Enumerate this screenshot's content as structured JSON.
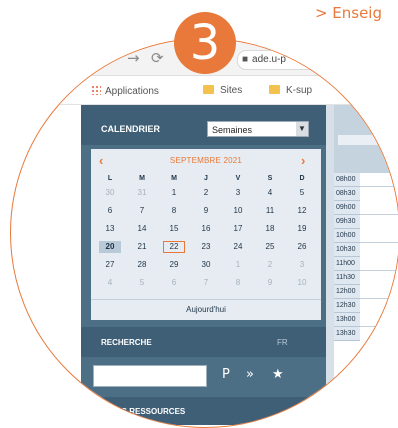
{
  "breadcrumb": "> Enseig",
  "step_badge": "3",
  "browser": {
    "url": "ade.u-p",
    "back_icon": "←",
    "forward_icon": "→",
    "reload_icon": "⟳",
    "bookmarks": [
      {
        "label": "Applications",
        "icon": "apps-grid-icon"
      },
      {
        "label": "Sites",
        "icon": "folder-icon"
      },
      {
        "label": "K-sup",
        "icon": "folder-icon"
      }
    ]
  },
  "calendar": {
    "title": "CALENDRIER",
    "view_select": "Semaines",
    "month": "SEPTEMBRE 2021",
    "weekdays": [
      "L",
      "M",
      "M",
      "J",
      "V",
      "S",
      "D"
    ],
    "weeks": [
      [
        "30",
        "31",
        "1",
        "2",
        "3",
        "4",
        "5"
      ],
      [
        "6",
        "7",
        "8",
        "9",
        "10",
        "11",
        "12"
      ],
      [
        "13",
        "14",
        "15",
        "16",
        "17",
        "18",
        "19"
      ],
      [
        "20",
        "21",
        "22",
        "23",
        "24",
        "25",
        "26"
      ],
      [
        "27",
        "28",
        "29",
        "30",
        "1",
        "2",
        "3"
      ],
      [
        "4",
        "5",
        "6",
        "7",
        "8",
        "9",
        "10"
      ]
    ],
    "today_label": "Aujourd'hui"
  },
  "search": {
    "title": "RECHERCHE",
    "lang": "FR",
    "input_value": "",
    "go_icon": "P",
    "more_icon": "»",
    "star_icon": "★"
  },
  "resources": {
    "title": "S DES RESSOURCES"
  },
  "schedule": {
    "times": [
      "08h00",
      "08h30",
      "09h00",
      "09h30",
      "10h00",
      "10h30",
      "11h00",
      "11h30",
      "12h00",
      "12h30",
      "13h00",
      "13h30"
    ]
  },
  "colors": {
    "accent": "#e8793a",
    "sidebar": "#4d6f86",
    "sidebar_header": "#3f5f76",
    "calendar_bg": "#e6ecf2"
  }
}
